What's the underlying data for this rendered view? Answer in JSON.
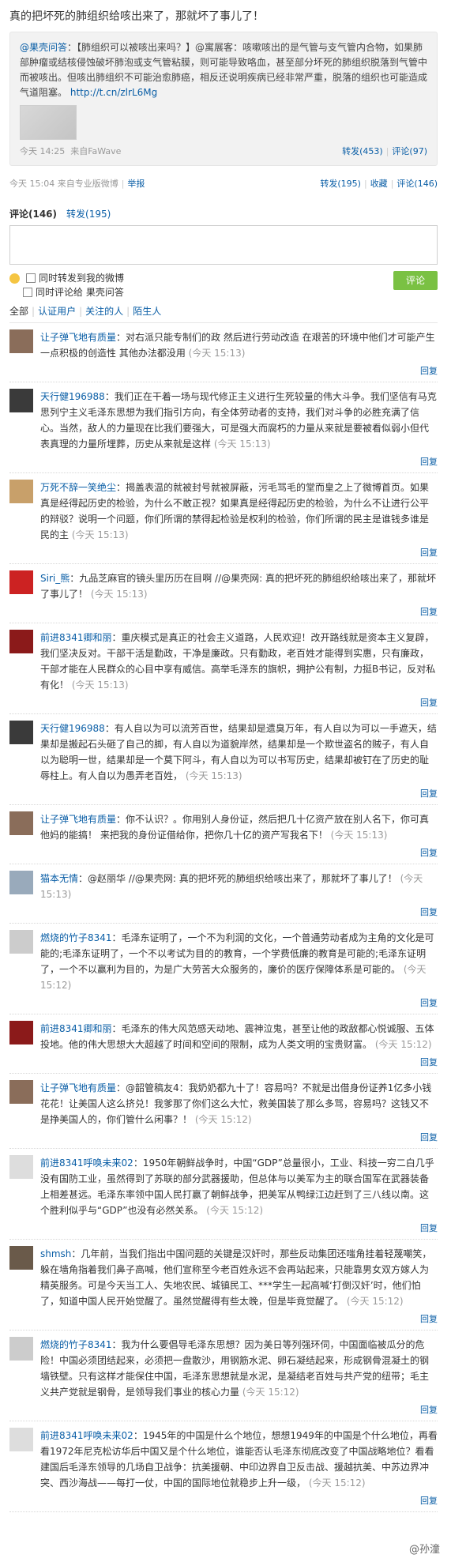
{
  "post": {
    "text": "真的把坏死的肺组织给咳出来了，那就坏了事儿了！",
    "forward": {
      "author": "@果壳问答",
      "text": "：【肺组织可以被咳出来吗？】@寓展客：咳嗽咳出的是气管与支气管内合物，如果肺部肿瘤或结核侵蚀破坏肺泡或支气管粘膜，则可能导致咯血，甚至部分坏死的肺组织脱落到气管中而被咳出。但咳出肺组织不可能治愈肺癌，相反还说明疾病已经非常严重，脱落的组织也可能造成气道阻塞。",
      "url": "http://t.cn/zlrL6Mg",
      "time": "今天 14:25",
      "source": "来自FaWave",
      "repost": "转发(453)",
      "comment": "评论(97)"
    },
    "meta": "今天 15:04 来自专业版微博",
    "report": "举报",
    "repost": "转发(195)",
    "favorite": "收藏",
    "comment": "评论(146)"
  },
  "comment_area": {
    "tab_comment": "评论(146)",
    "tab_repost": "转发(195)",
    "check_repost": "同时转发到我的微博",
    "check_origin": "同时评论给 果壳问答",
    "submit": "评论",
    "filters": [
      "全部",
      "认证用户",
      "关注的人",
      "陌生人"
    ]
  },
  "comments": [
    {
      "user": "让子弹飞地有质量",
      "text": "：对右派只能专制们的政 然后进行劳动改造 在艰苦的环境中他们才可能产生一点积极的创造性 其他办法都没用",
      "time": "(今天 15:13)",
      "avatar": "#8a6d5a"
    },
    {
      "user": "天行健196988",
      "text": "：我们正在干着一场与现代修正主义进行生死较量的伟大斗争。我们坚信有马克思列宁主义毛泽东思想为我们指引方向，有全体劳动者的支持，我们对斗争的必胜充满了信心。当然，敌人的力量现在比我们要强大，可是强大而腐朽的力量从来就是要被看似弱小但代表真理的力量所埋葬，历史从来就是这样",
      "time": "(今天 15:13)",
      "avatar": "#3a3a3a"
    },
    {
      "user": "万死不辞一笑绝尘",
      "text": "：揭盖表温的就被封号就被屏蔽，污毛骂毛的堂而皇之上了微博首页。如果真是经得起历史的检验，为什么不敢正视？如果真是经得起历史的检验，为什么不让进行公平的辩驳？说明一个问题，你们所谓的禁得起检验是权利的检验，你们所谓的民主是谁钱多谁是民的主",
      "time": "(今天 15:13)",
      "avatar": "#c8a06a"
    },
    {
      "user": "Siri_熊",
      "text": "：九品芝麻官的镜头里历历在目啊 //@果壳网: 真的把坏死的肺组织给咳出来了，那就坏了事儿了！",
      "time": "(今天 15:13)",
      "avatar": "#cc2222"
    },
    {
      "user": "前进8341卿和丽",
      "text": "：重庆模式是真正的社会主义道路，人民欢迎！改开路线就是资本主义复辟，我们坚决反对。干部干活是勤政，干净是廉政。只有勤政，老百姓才能得到实惠，只有廉政，干部才能在人民群众的心目中享有威信。高举毛泽东的旗帜，拥护公有制，力挺B书记，反对私有化！",
      "time": "(今天 15:13)",
      "avatar": "#8b1a1a"
    },
    {
      "user": "天行健196988",
      "text": "：有人自以为可以流芳百世，结果却是遗臭万年，有人自以为可以一手遮天，结果却是搬起石头砸了自己的脚，有人自以为道貌岸然，结果却是一个欺世盗名的贼子，有人自以为聪明一世，结果却是一个莫下阿斗，有人自以为可以书写历史，结果却被钉在了历史的耻辱柱上。有人自以为愚弄老百姓，",
      "time": "(今天 15:13)",
      "avatar": "#3a3a3a"
    },
    {
      "user": "让子弹飞地有质量",
      "text": "：你不认识？。你用别人身份证，然后把几十亿资产放在别人名下，你可真他妈的能搞！ 来把我的身份证借给你，把你几十亿的资产写我名下！",
      "time": "(今天 15:13)",
      "avatar": "#8a6d5a"
    },
    {
      "user": "猫本无情",
      "text": "：@赵丽华 //@果壳网: 真的把坏死的肺组织给咳出来了，那就坏了事儿了！",
      "time": "(今天 15:13)",
      "avatar": "#9ab"
    },
    {
      "user": "燃烧的竹子8341",
      "text": "：毛泽东证明了，一个不为利润的文化，一个普通劳动者成为主角的文化是可能的;毛泽东证明了，一个不以考试为目的的教育，一个学费低廉的教育是可能的;毛泽东证明了，一个不以赢利为目的，为是广大劳苦大众服务的，廉价的医疗保障体系是可能的。",
      "time": "(今天 15:12)",
      "avatar": "#ccc"
    },
    {
      "user": "前进8341卿和丽",
      "text": "：毛泽东的伟大风范感天动地、震神泣鬼，甚至让他的政敌都心悦诚服、五体投地。他的伟大思想大大超越了时间和空间的限制，成为人类文明的宝贵财富。",
      "time": "(今天 15:12)",
      "avatar": "#8b1a1a"
    },
    {
      "user": "让子弹飞地有质量",
      "text": "：@韶管稿友4：我奶奶都九十了！容易吗？不就是出借身份证养1亿多小钱花花！让美国人这么挤兑！我爹那了你们这么大忙，救美国装了那么多骂，容易吗？这钱又不是挣美国人的，你们管什么闲事？！",
      "time": "(今天 15:12)",
      "avatar": "#8a6d5a"
    },
    {
      "user": "前进8341呼唤未来02",
      "text": "：1950年朝鲜战争时，中国“GDP”总量很小，工业、科技一穷二白几乎没有国防工业，虽然得到了苏联的部分武器援助，但总体与以美军为主的联合国军在武器装备上相差甚远。毛泽东率领中国人民打赢了朝鲜战争，把美军从鸭绿江边赶到了三八线以南。这个胜利似乎与“GDP”也没有必然关系。",
      "time": "(今天 15:12)",
      "avatar": "#ddd"
    },
    {
      "user": "shmsh",
      "text": "：几年前，当我们指出中国问题的关键是汉奸时，那些反动集团还嗤角挂着轻蔑嘲笑，躲在墙角指着我们鼻子高喊，他们宣称至今老百姓永远不会再站起来，只能靠男女双方嫁人为精英服务。可是今天当工人、失地农民、城镇民工、***学生一起高喊‘打倒汉奸’时，他们怕了，知道中国人民开始觉醒了。虽然觉醒得有些太晚，但是毕竟觉醒了。",
      "time": "(今天 15:12)",
      "avatar": "#6a5a4a"
    },
    {
      "user": "燃烧的竹子8341",
      "text": "：我为什么要倡导毛泽东思想？因为美日等列强环伺，中国面临被瓜分的危险！中国必须团结起来，必须把一盘散沙，用钢筋水泥、卵石凝结起来，形成钢骨混凝土的钢墙铁壁。只有这样才能保住中国，毛泽东思想就是水泥，是凝结老百姓与共产党的纽带；毛主义共产党就是钢骨，是领导我们事业的核心力量",
      "time": "(今天 15:12)",
      "avatar": "#ccc"
    },
    {
      "user": "前进8341呼唤未来02",
      "text": "：1945年的中国是什么个地位，想想1949年的中国是个什么地位，再看看1972年尼克松访华后中国又是个什么地位，谁能否认毛泽东彻底改变了中国战略地位？看看建国后毛泽东领导的几场自卫战争：抗美援朝、中印边界自卫反击战、援越抗美、中苏边界冲突、西沙海战——每打一仗，中国的国际地位就稳步上升一级，",
      "time": "(今天 15:12)",
      "avatar": "#ddd"
    }
  ],
  "reply_label": "回复",
  "watermark": "@孙潼"
}
